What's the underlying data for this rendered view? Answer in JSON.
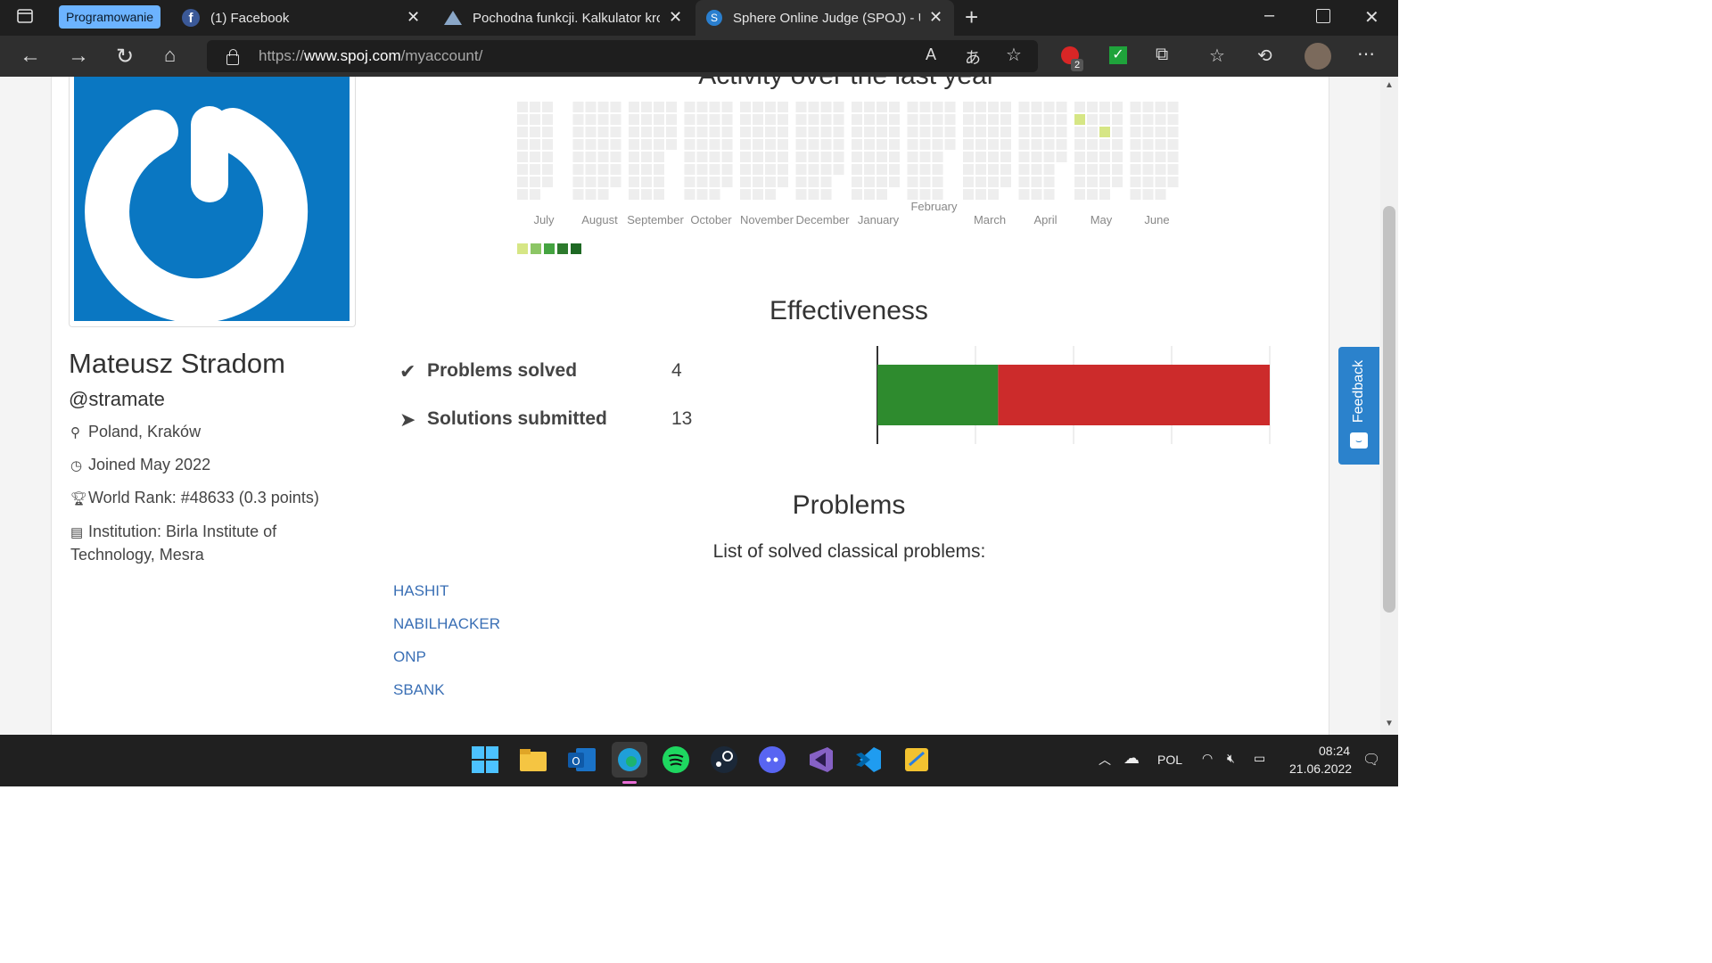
{
  "browser": {
    "tab_group": "Programowanie",
    "tabs": [
      {
        "label": "(1) Facebook"
      },
      {
        "label": "Pochodna funkcji. Kalkulator krok"
      },
      {
        "label": "Sphere Online Judge (SPOJ) - Us"
      }
    ],
    "url_prefix": "https://",
    "url_host": "www.spoj.com",
    "url_path": "/myaccount/",
    "notification_badge": "2"
  },
  "activity": {
    "title": "Activity over the last year",
    "months": [
      "July",
      "August",
      "September",
      "October",
      "November",
      "December",
      "January",
      "February",
      "March",
      "April",
      "May",
      "June"
    ],
    "legend_colors": [
      "#d6e685",
      "#8cc665",
      "#44a340",
      "#2d7a2d",
      "#1e6823"
    ],
    "active_color": "#d6e685",
    "empty_color": "#eeeeee"
  },
  "profile": {
    "name": "Mateusz Stradom",
    "handle": "@stramate",
    "location": "Poland, Kraków",
    "joined": "Joined May 2022",
    "rank": "World Rank: #48633 (0.3 points)",
    "institution": "Institution: Birla Institute of Technology, Mesra"
  },
  "effectiveness": {
    "title": "Effectiveness",
    "problems_solved_label": "Problems solved",
    "problems_solved": "4",
    "solutions_submitted_label": "Solutions submitted",
    "solutions_submitted": "13",
    "solved_color": "#2e8b2e",
    "failed_color": "#cc2b2b"
  },
  "problems": {
    "title": "Problems",
    "subtitle": "List of solved classical problems:",
    "items": [
      "HASHIT",
      "NABILHACKER",
      "ONP",
      "SBANK"
    ]
  },
  "feedback_label": "Feedback",
  "taskbar": {
    "language": "POL",
    "time": "08:24",
    "date": "21.06.2022"
  }
}
